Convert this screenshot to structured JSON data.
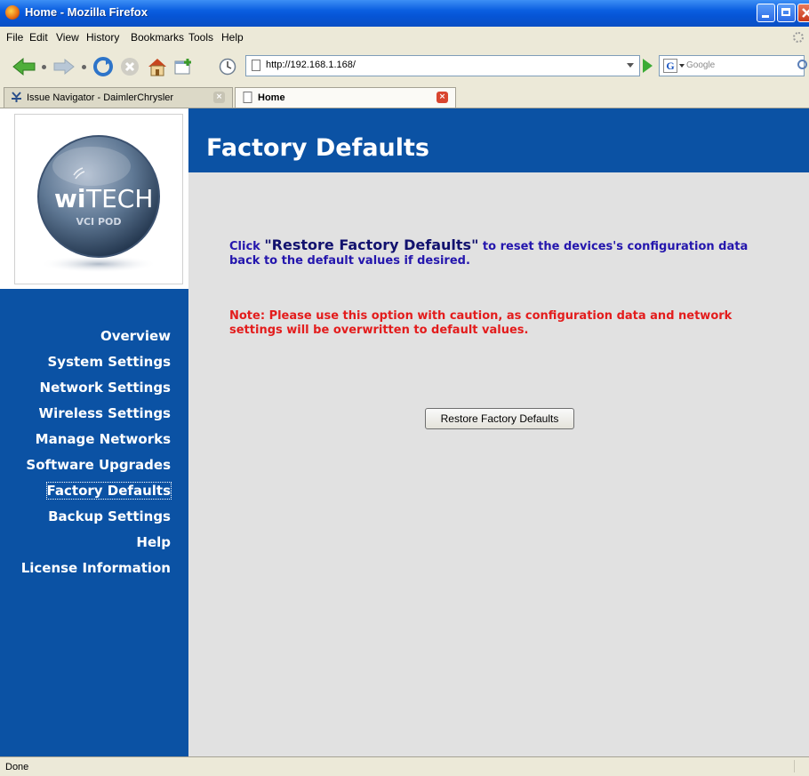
{
  "window": {
    "title": "Home - Mozilla Firefox"
  },
  "menu": [
    "File",
    "Edit",
    "View",
    "History",
    "Bookmarks",
    "Tools",
    "Help"
  ],
  "address": {
    "url": "http://192.168.1.168/"
  },
  "search": {
    "placeholder": "Google"
  },
  "tabs": [
    {
      "label": "Issue Navigator - DaimlerChrysler",
      "active": false
    },
    {
      "label": "Home",
      "active": true
    }
  ],
  "logo": {
    "brand_wi": "wi",
    "brand_tech": "TECH",
    "subtitle": "VCI POD"
  },
  "sidebar": {
    "items": [
      {
        "label": "Overview"
      },
      {
        "label": "System Settings"
      },
      {
        "label": "Network Settings"
      },
      {
        "label": "Wireless Settings"
      },
      {
        "label": "Manage Networks"
      },
      {
        "label": "Software Upgrades"
      },
      {
        "label": "Factory Defaults",
        "current": true
      },
      {
        "label": "Backup Settings"
      },
      {
        "label": "Help"
      },
      {
        "label": "License Information"
      }
    ]
  },
  "page": {
    "title": "Factory Defaults",
    "info_prefix": "Click ",
    "info_emphasis": "\"Restore Factory Defaults\"",
    "info_suffix": " to reset the devices's configuration data back to the default values if desired.",
    "note": "Note: Please use this option with caution, as configuration data and network settings will be overwritten to default values.",
    "restore_button": "Restore Factory Defaults"
  },
  "status": {
    "text": "Done"
  },
  "colors": {
    "brand_blue": "#0b52a4",
    "warning_red": "#e31c1c",
    "info_blue": "#2416ad"
  }
}
